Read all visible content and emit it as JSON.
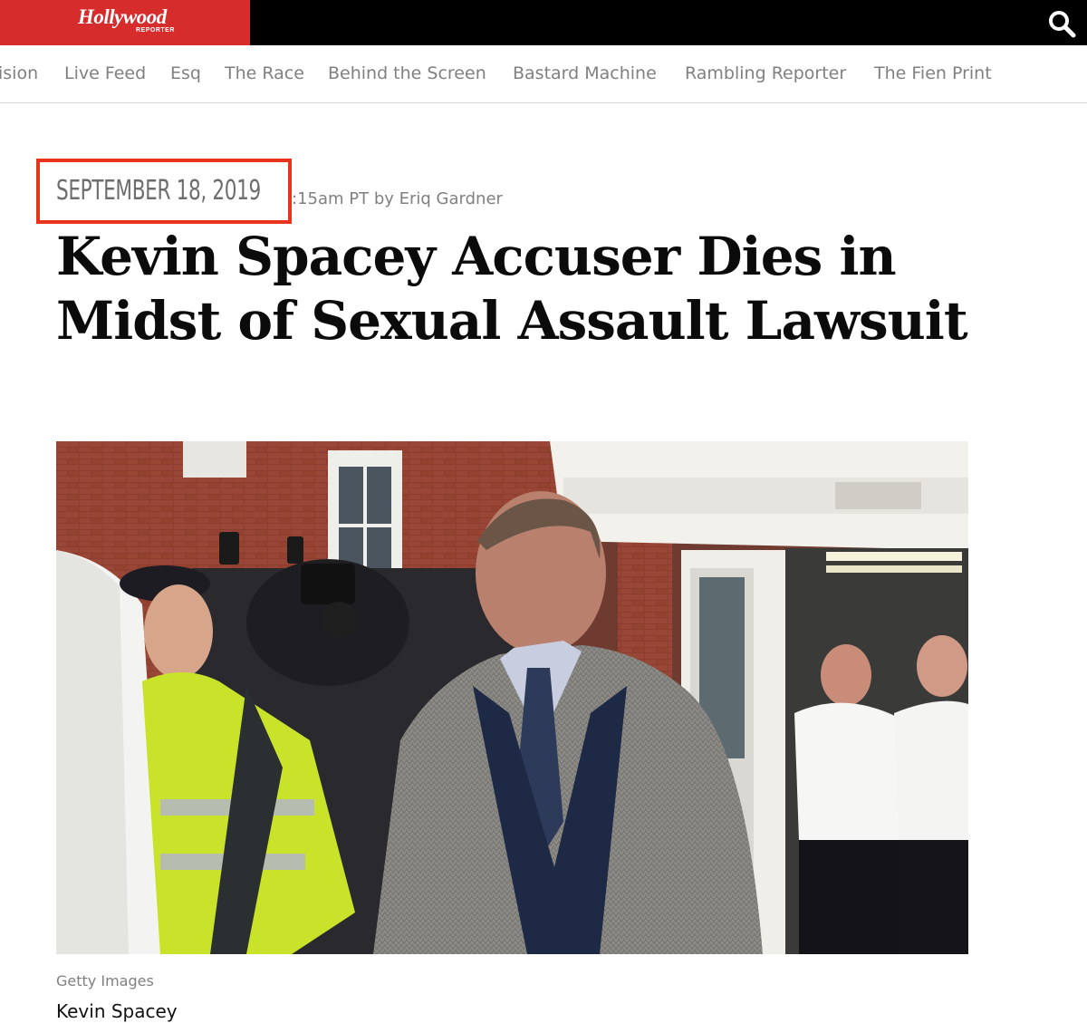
{
  "header": {
    "logo_main": "Hollywood",
    "logo_sub": "REPORTER",
    "search_icon": "search-icon"
  },
  "nav": {
    "items": [
      "ision",
      "Live Feed",
      "Esq",
      "The Race",
      "Behind the Screen",
      "Bastard Machine",
      "Rambling Reporter",
      "The Fien Print"
    ]
  },
  "article": {
    "date": "SEPTEMBER 18, 2019",
    "byline": ":15am PT by Eriq Gardner",
    "headline": "Kevin Spacey Accuser Dies in Midst of Sexual Assault Lawsuit",
    "photo_credit": "Getty Images",
    "photo_caption": "Kevin Spacey"
  },
  "colors": {
    "brand_red": "#d62c2c",
    "highlight_box": "#e8341c"
  }
}
